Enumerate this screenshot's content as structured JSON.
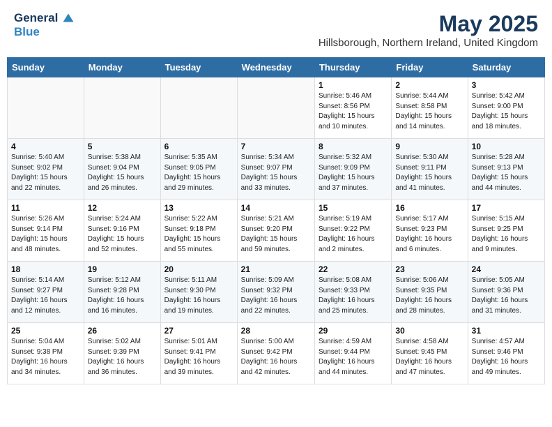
{
  "header": {
    "logo_line1": "General",
    "logo_line2": "Blue",
    "main_title": "May 2025",
    "subtitle": "Hillsborough, Northern Ireland, United Kingdom"
  },
  "days_of_week": [
    "Sunday",
    "Monday",
    "Tuesday",
    "Wednesday",
    "Thursday",
    "Friday",
    "Saturday"
  ],
  "weeks": [
    [
      {
        "day": "",
        "info": ""
      },
      {
        "day": "",
        "info": ""
      },
      {
        "day": "",
        "info": ""
      },
      {
        "day": "",
        "info": ""
      },
      {
        "day": "1",
        "info": "Sunrise: 5:46 AM\nSunset: 8:56 PM\nDaylight: 15 hours\nand 10 minutes."
      },
      {
        "day": "2",
        "info": "Sunrise: 5:44 AM\nSunset: 8:58 PM\nDaylight: 15 hours\nand 14 minutes."
      },
      {
        "day": "3",
        "info": "Sunrise: 5:42 AM\nSunset: 9:00 PM\nDaylight: 15 hours\nand 18 minutes."
      }
    ],
    [
      {
        "day": "4",
        "info": "Sunrise: 5:40 AM\nSunset: 9:02 PM\nDaylight: 15 hours\nand 22 minutes."
      },
      {
        "day": "5",
        "info": "Sunrise: 5:38 AM\nSunset: 9:04 PM\nDaylight: 15 hours\nand 26 minutes."
      },
      {
        "day": "6",
        "info": "Sunrise: 5:35 AM\nSunset: 9:05 PM\nDaylight: 15 hours\nand 29 minutes."
      },
      {
        "day": "7",
        "info": "Sunrise: 5:34 AM\nSunset: 9:07 PM\nDaylight: 15 hours\nand 33 minutes."
      },
      {
        "day": "8",
        "info": "Sunrise: 5:32 AM\nSunset: 9:09 PM\nDaylight: 15 hours\nand 37 minutes."
      },
      {
        "day": "9",
        "info": "Sunrise: 5:30 AM\nSunset: 9:11 PM\nDaylight: 15 hours\nand 41 minutes."
      },
      {
        "day": "10",
        "info": "Sunrise: 5:28 AM\nSunset: 9:13 PM\nDaylight: 15 hours\nand 44 minutes."
      }
    ],
    [
      {
        "day": "11",
        "info": "Sunrise: 5:26 AM\nSunset: 9:14 PM\nDaylight: 15 hours\nand 48 minutes."
      },
      {
        "day": "12",
        "info": "Sunrise: 5:24 AM\nSunset: 9:16 PM\nDaylight: 15 hours\nand 52 minutes."
      },
      {
        "day": "13",
        "info": "Sunrise: 5:22 AM\nSunset: 9:18 PM\nDaylight: 15 hours\nand 55 minutes."
      },
      {
        "day": "14",
        "info": "Sunrise: 5:21 AM\nSunset: 9:20 PM\nDaylight: 15 hours\nand 59 minutes."
      },
      {
        "day": "15",
        "info": "Sunrise: 5:19 AM\nSunset: 9:22 PM\nDaylight: 16 hours\nand 2 minutes."
      },
      {
        "day": "16",
        "info": "Sunrise: 5:17 AM\nSunset: 9:23 PM\nDaylight: 16 hours\nand 6 minutes."
      },
      {
        "day": "17",
        "info": "Sunrise: 5:15 AM\nSunset: 9:25 PM\nDaylight: 16 hours\nand 9 minutes."
      }
    ],
    [
      {
        "day": "18",
        "info": "Sunrise: 5:14 AM\nSunset: 9:27 PM\nDaylight: 16 hours\nand 12 minutes."
      },
      {
        "day": "19",
        "info": "Sunrise: 5:12 AM\nSunset: 9:28 PM\nDaylight: 16 hours\nand 16 minutes."
      },
      {
        "day": "20",
        "info": "Sunrise: 5:11 AM\nSunset: 9:30 PM\nDaylight: 16 hours\nand 19 minutes."
      },
      {
        "day": "21",
        "info": "Sunrise: 5:09 AM\nSunset: 9:32 PM\nDaylight: 16 hours\nand 22 minutes."
      },
      {
        "day": "22",
        "info": "Sunrise: 5:08 AM\nSunset: 9:33 PM\nDaylight: 16 hours\nand 25 minutes."
      },
      {
        "day": "23",
        "info": "Sunrise: 5:06 AM\nSunset: 9:35 PM\nDaylight: 16 hours\nand 28 minutes."
      },
      {
        "day": "24",
        "info": "Sunrise: 5:05 AM\nSunset: 9:36 PM\nDaylight: 16 hours\nand 31 minutes."
      }
    ],
    [
      {
        "day": "25",
        "info": "Sunrise: 5:04 AM\nSunset: 9:38 PM\nDaylight: 16 hours\nand 34 minutes."
      },
      {
        "day": "26",
        "info": "Sunrise: 5:02 AM\nSunset: 9:39 PM\nDaylight: 16 hours\nand 36 minutes."
      },
      {
        "day": "27",
        "info": "Sunrise: 5:01 AM\nSunset: 9:41 PM\nDaylight: 16 hours\nand 39 minutes."
      },
      {
        "day": "28",
        "info": "Sunrise: 5:00 AM\nSunset: 9:42 PM\nDaylight: 16 hours\nand 42 minutes."
      },
      {
        "day": "29",
        "info": "Sunrise: 4:59 AM\nSunset: 9:44 PM\nDaylight: 16 hours\nand 44 minutes."
      },
      {
        "day": "30",
        "info": "Sunrise: 4:58 AM\nSunset: 9:45 PM\nDaylight: 16 hours\nand 47 minutes."
      },
      {
        "day": "31",
        "info": "Sunrise: 4:57 AM\nSunset: 9:46 PM\nDaylight: 16 hours\nand 49 minutes."
      }
    ]
  ]
}
